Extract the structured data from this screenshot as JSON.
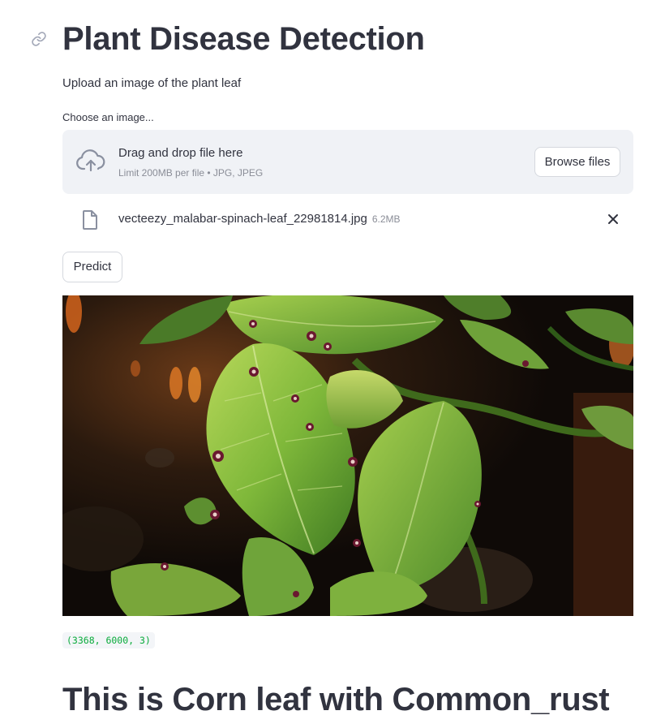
{
  "header": {
    "title": "Plant Disease Detection",
    "anchor_icon": "link-icon"
  },
  "intro": {
    "text": "Upload an image of the plant leaf"
  },
  "uploader": {
    "label": "Choose an image...",
    "drop_title": "Drag and drop file here",
    "drop_limit": "Limit 200MB per file • JPG, JPEG",
    "browse_label": "Browse files",
    "icon": "cloud-upload-icon"
  },
  "uploaded_file": {
    "name": "vecteezy_malabar-spinach-leaf_22981814.jpg",
    "size": "6.2MB",
    "icon": "file-icon",
    "remove_icon": "close-icon"
  },
  "actions": {
    "predict_label": "Predict"
  },
  "preview": {
    "image_subject": "malabar spinach leaves with leaf spots"
  },
  "output": {
    "shape": "(3368, 6000, 3)",
    "shape_color": "#09ab3b",
    "result_text": "This is Corn leaf with Common_rust"
  },
  "colors": {
    "text": "#31333f",
    "muted": "#8a8d97",
    "dropzone_bg": "#f0f2f6",
    "border": "#d5d8de"
  }
}
